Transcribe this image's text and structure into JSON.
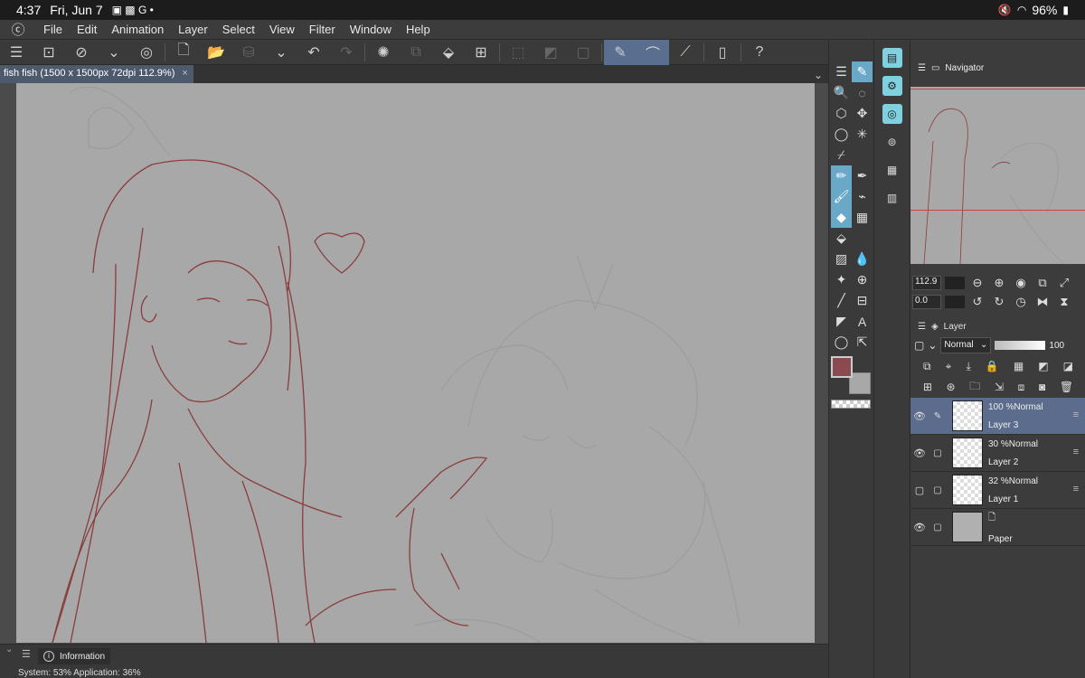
{
  "status_bar": {
    "time": "4:37",
    "date": "Fri, Jun 7",
    "battery": "96%"
  },
  "menu": {
    "items": [
      "File",
      "Edit",
      "Animation",
      "Layer",
      "Select",
      "View",
      "Filter",
      "Window",
      "Help"
    ]
  },
  "tab": {
    "title": "fish fish (1500 x 1500px 72dpi 112.9%)",
    "close": "×"
  },
  "info_panel": {
    "tab_label": "Information",
    "text": "System: 53% Application: 36%"
  },
  "navigator": {
    "title": "Navigator",
    "zoom": "112.9",
    "rotation": "0.0"
  },
  "layer_panel": {
    "title": "Layer",
    "blend_mode": "Normal",
    "opacity": "100",
    "layers": [
      {
        "opacity": "100 %",
        "mode": "Normal",
        "name": "Layer 3"
      },
      {
        "opacity": "30 %",
        "mode": "Normal",
        "name": "Layer 2"
      },
      {
        "opacity": "32 %",
        "mode": "Normal",
        "name": "Layer 1"
      },
      {
        "opacity": "",
        "mode": "",
        "name": "Paper"
      }
    ]
  },
  "colors": {
    "main": "#8b4a4f",
    "sub": "#a8a8a8",
    "canvas": "#a8a8a8",
    "selection": "#5b6c8c"
  }
}
